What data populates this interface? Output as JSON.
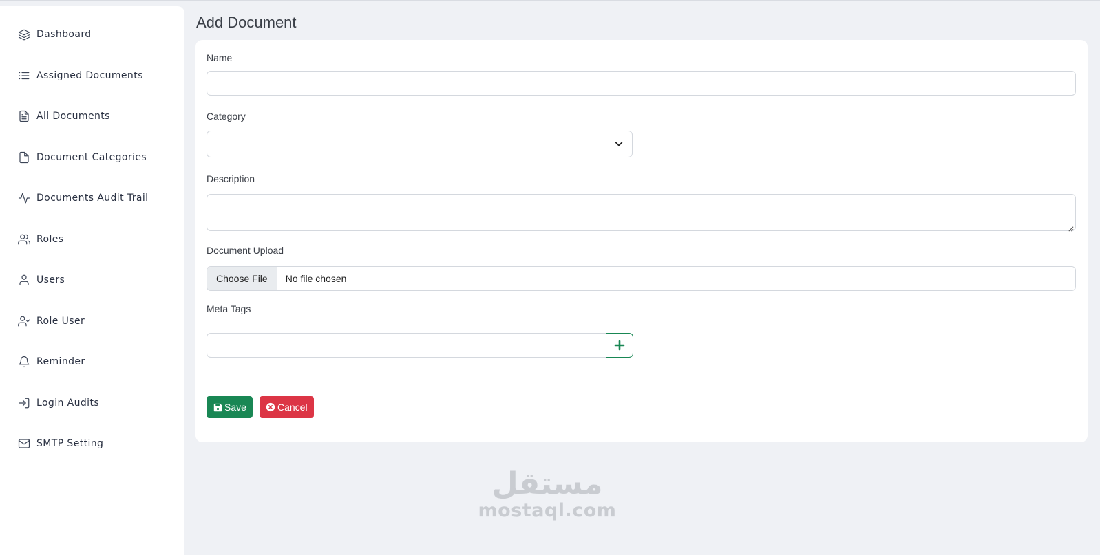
{
  "sidebar": {
    "items": [
      {
        "label": "Dashboard",
        "icon": "layers-icon"
      },
      {
        "label": "Assigned Documents",
        "icon": "list-icon"
      },
      {
        "label": "All Documents",
        "icon": "file-text-icon"
      },
      {
        "label": "Document Categories",
        "icon": "file-icon"
      },
      {
        "label": "Documents Audit Trail",
        "icon": "activity-icon"
      },
      {
        "label": "Roles",
        "icon": "users-icon"
      },
      {
        "label": "Users",
        "icon": "user-icon"
      },
      {
        "label": "Role User",
        "icon": "user-check-icon"
      },
      {
        "label": "Reminder",
        "icon": "bell-icon"
      },
      {
        "label": "Login Audits",
        "icon": "log-in-icon"
      },
      {
        "label": "SMTP Setting",
        "icon": "mail-icon"
      }
    ]
  },
  "page": {
    "title": "Add Document"
  },
  "form": {
    "name": {
      "label": "Name",
      "value": ""
    },
    "category": {
      "label": "Category",
      "value": ""
    },
    "description": {
      "label": "Description",
      "value": ""
    },
    "upload": {
      "label": "Document Upload",
      "button": "Choose File",
      "status": "No file chosen"
    },
    "meta_tags": {
      "label": "Meta Tags",
      "value": ""
    }
  },
  "actions": {
    "save": "Save",
    "cancel": "Cancel"
  },
  "watermark": {
    "arabic": "مستقل",
    "latin": "mostaql.com"
  },
  "colors": {
    "success": "#198754",
    "danger": "#dc3545",
    "background": "#eff1f5"
  }
}
